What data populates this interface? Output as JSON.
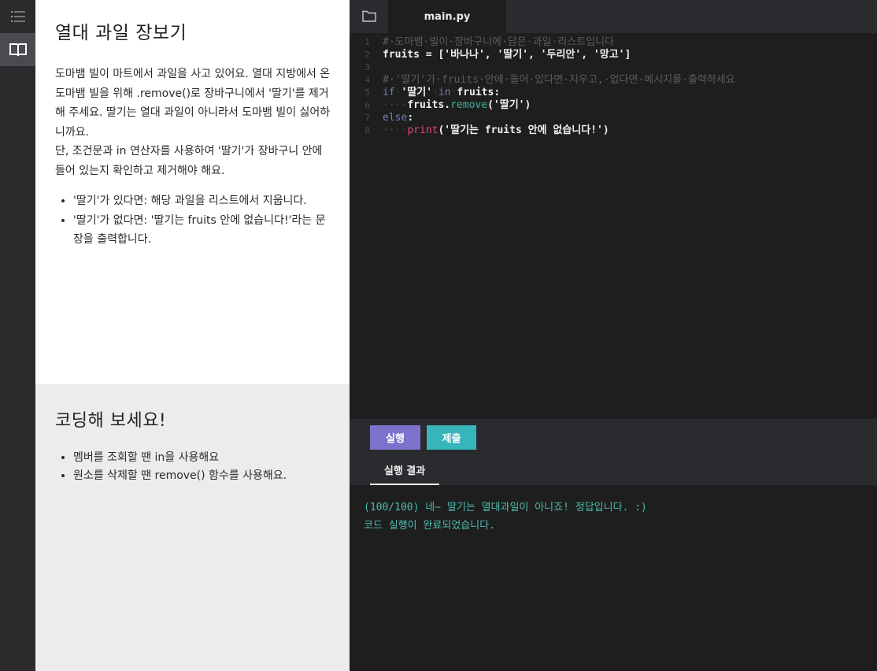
{
  "rail": {
    "items": [
      {
        "icon": "list-icon"
      },
      {
        "icon": "book-icon",
        "active": true
      }
    ]
  },
  "instructions": {
    "title": "열대 과일 장보기",
    "p1": "도마뱀 빌이 마트에서 과일을 사고 있어요. 열대 지방에서 온 도마뱀 빌을 위해 .remove()로 장바구니에서 '딸기'를 제거해 주세요. 딸기는 열대 과일이 아니라서 도마뱀 빌이 싫어하니까요.",
    "p2": "단, 조건문과 in 연산자를 사용하여 '딸기'가 장바구니 안에 들어 있는지 확인하고 제거해야 해요.",
    "bullets": [
      "'딸기'가 있다면: 해당 과일을 리스트에서 지웁니다.",
      "'딸기'가 없다면: '딸기는 fruits 안에 없습니다!'라는 문장을 출력합니다."
    ]
  },
  "hint": {
    "title": "코딩해 보세요!",
    "bullets": [
      "멤버를 조회할 땐 in을 사용해요",
      "원소를 삭제할 땐 remove() 함수를 사용해요."
    ]
  },
  "editor": {
    "tab_label": "main.py",
    "line_numbers": [
      "1",
      "2",
      "3",
      "4",
      "5",
      "6",
      "7",
      "8"
    ],
    "lines": {
      "l1": "#·도마뱀·빌이·장바구니에·담은·과일·리스트입니다",
      "l2": "fruits = ['바나나', '딸기', '두리안', '망고']",
      "l4": "#·'딸기'가·fruits·안에·들어·있다면·지우고,·없다면·메시지를·출력하세요",
      "l5_kw1": "if",
      "l5_str": "'딸기'",
      "l5_kw2": "in",
      "l5_rest": "fruits:",
      "l6_pre": "fruits.",
      "l6_method": "remove",
      "l6_arg": "('딸기')",
      "l7_kw": "else",
      "l7_colon": ":",
      "l8_fn": "print",
      "l8_arg": "('딸기는 fruits 안에 없습니다!')"
    }
  },
  "controls": {
    "run_label": "실행",
    "submit_label": "제출"
  },
  "output": {
    "tab_label": "실행 결과",
    "lines": [
      "(100/100) 네~ 딸기는 열대과일이 아니죠! 정답입니다. :)",
      "코드 실행이 완료되었습니다."
    ]
  }
}
